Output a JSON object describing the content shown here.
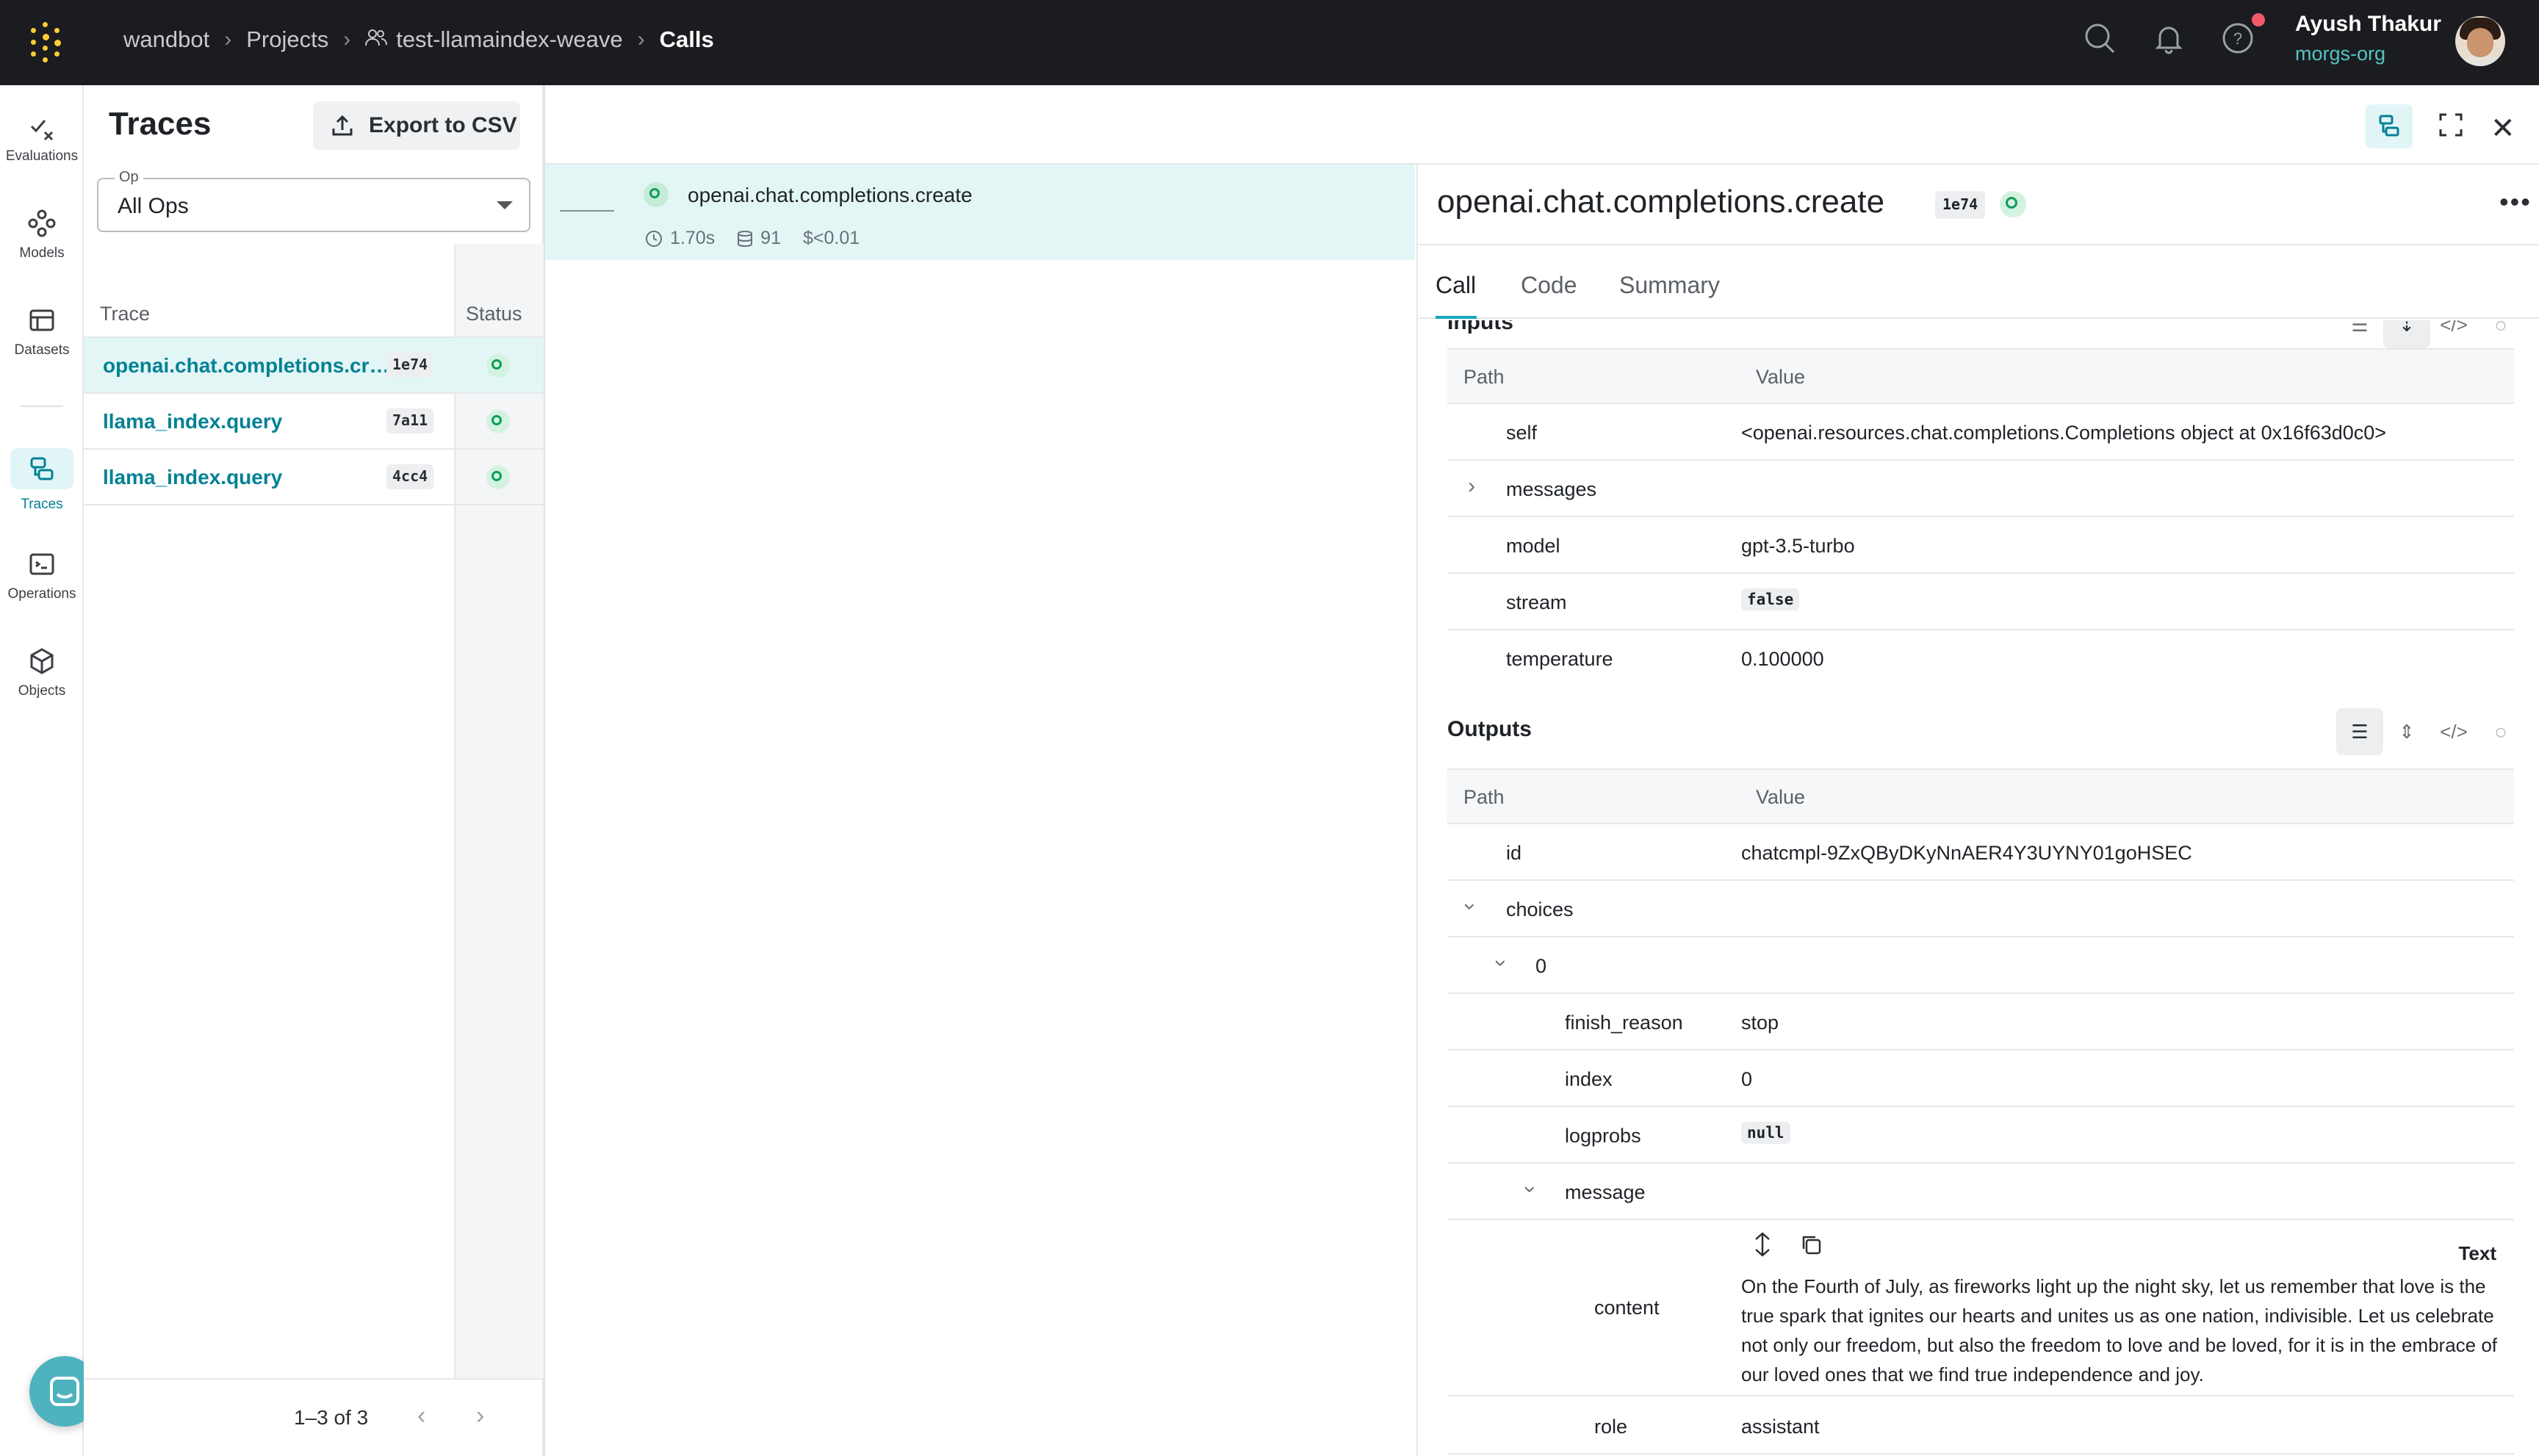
{
  "header": {
    "breadcrumbs": [
      "wandbot",
      "Projects",
      "test-llamaindex-weave",
      "Calls"
    ],
    "user_name": "Ayush Thakur",
    "org_name": "morgs-org"
  },
  "nav": {
    "items": [
      {
        "label": "Evaluations",
        "icon": "evaluations-icon"
      },
      {
        "label": "Models",
        "icon": "models-icon"
      },
      {
        "label": "Datasets",
        "icon": "datasets-icon"
      },
      {
        "label": "Traces",
        "icon": "traces-icon",
        "active": true
      },
      {
        "label": "Operations",
        "icon": "operations-icon"
      },
      {
        "label": "Objects",
        "icon": "objects-icon"
      }
    ]
  },
  "traces": {
    "title": "Traces",
    "export_label": "Export to CSV",
    "op_label": "Op",
    "op_value": "All Ops",
    "columns": [
      "Trace",
      "Status"
    ],
    "rows": [
      {
        "name": "openai.chat.completions.cre…",
        "id": "1e74",
        "selected": true
      },
      {
        "name": "llama_index.query",
        "id": "7a11"
      },
      {
        "name": "llama_index.query",
        "id": "4cc4"
      }
    ],
    "pager": "1–3 of 3"
  },
  "tree": {
    "name": "openai.chat.completions.create",
    "latency": "1.70s",
    "tokens": "91",
    "cost": "$<0.01"
  },
  "detail": {
    "title": "openai.chat.completions.create",
    "badge": "1e74",
    "tabs": [
      "Call",
      "Code",
      "Summary"
    ],
    "inputs_label": "Inputs",
    "outputs_label": "Outputs",
    "path_header": "Path",
    "value_header": "Value",
    "inputs": {
      "self": "<openai.resources.chat.completions.Completions object at 0x16f63d0c0>",
      "messages": "messages",
      "model": "gpt-3.5-turbo",
      "stream": "false",
      "temperature": "0.100000"
    },
    "outputs": {
      "id": "chatcmpl-9ZxQByDKyNnAER4Y3UYNY01goHSEC",
      "choices": "choices",
      "index_zero": "0",
      "finish_reason": "stop",
      "index": "0",
      "logprobs": "null",
      "message": "message",
      "content_label": "content",
      "content_kind": "Text",
      "content": "On the Fourth of July, as fireworks light up the night sky, let us remember that love is the true spark that ignites our hearts and unites us as one nation, indivisible. Let us celebrate not only our freedom, but also the freedom to love and be loved, for it is in the embrace of our loved ones that we find true independence and joy.",
      "role": "assistant"
    },
    "keys": {
      "self": "self",
      "model": "model",
      "stream": "stream",
      "temperature": "temperature",
      "id": "id",
      "finish_reason": "finish_reason",
      "index": "index",
      "logprobs": "logprobs",
      "role": "role"
    }
  }
}
